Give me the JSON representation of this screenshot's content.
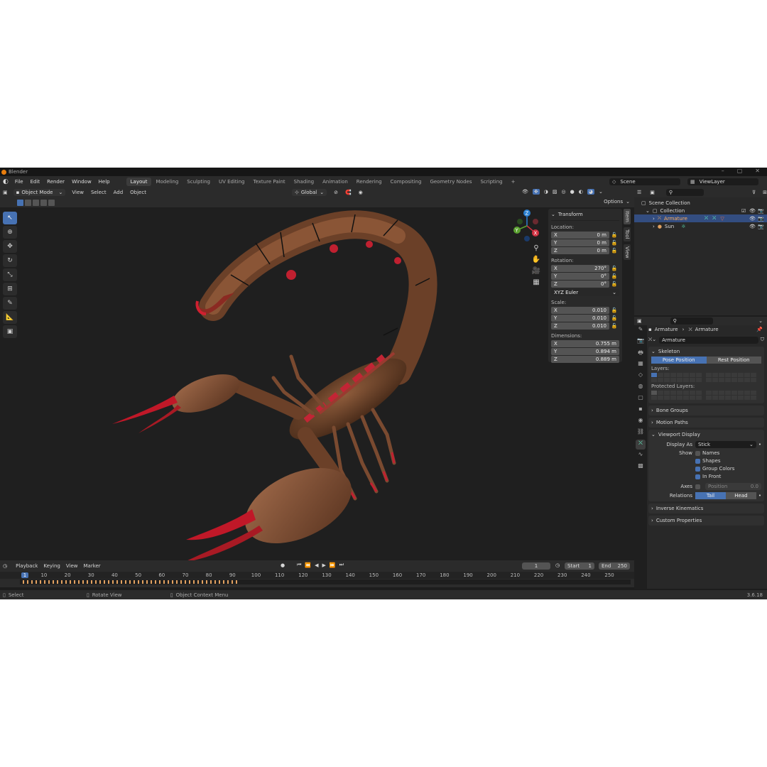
{
  "titlebar": {
    "title": "Blender"
  },
  "topbar": {
    "menus": [
      "File",
      "Edit",
      "Render",
      "Window",
      "Help"
    ],
    "workspaces": [
      "Layout",
      "Modeling",
      "Sculpting",
      "UV Editing",
      "Texture Paint",
      "Shading",
      "Animation",
      "Rendering",
      "Compositing",
      "Geometry Nodes",
      "Scripting"
    ],
    "active_workspace": "Layout",
    "add_tab": "+",
    "scene": "Scene",
    "view_layer": "ViewLayer"
  },
  "viewport_header": {
    "mode": "Object Mode",
    "menus": [
      "View",
      "Select",
      "Add",
      "Object"
    ],
    "orientation": "Global",
    "options": "Options"
  },
  "npanel": {
    "title": "Transform",
    "location_label": "Location:",
    "location": [
      {
        "axis": "X",
        "value": "0 m"
      },
      {
        "axis": "Y",
        "value": "0 m"
      },
      {
        "axis": "Z",
        "value": "0 m"
      }
    ],
    "rotation_label": "Rotation:",
    "rotation": [
      {
        "axis": "X",
        "value": "270°"
      },
      {
        "axis": "Y",
        "value": "0°"
      },
      {
        "axis": "Z",
        "value": "0°"
      }
    ],
    "rotation_mode": "XYZ Euler",
    "scale_label": "Scale:",
    "scale": [
      {
        "axis": "X",
        "value": "0.010"
      },
      {
        "axis": "Y",
        "value": "0.010"
      },
      {
        "axis": "Z",
        "value": "0.010"
      }
    ],
    "dimensions_label": "Dimensions:",
    "dimensions": [
      {
        "axis": "X",
        "value": "0.755 m"
      },
      {
        "axis": "Y",
        "value": "0.894 m"
      },
      {
        "axis": "Z",
        "value": "0.889 m"
      }
    ],
    "tabs": [
      "Item",
      "Tool",
      "View"
    ]
  },
  "gizmo": {
    "x": "X",
    "y": "Y",
    "z": "Z"
  },
  "timeline": {
    "menus": [
      "Playback",
      "Keying",
      "View",
      "Marker"
    ],
    "current_frame": "1",
    "start_label": "Start",
    "start": "1",
    "end_label": "End",
    "end": "250",
    "ruler": [
      "1",
      "10",
      "20",
      "30",
      "40",
      "50",
      "60",
      "70",
      "80",
      "90",
      "100",
      "110",
      "120",
      "130",
      "140",
      "150",
      "160",
      "170",
      "180",
      "190",
      "200",
      "210",
      "220",
      "230",
      "240",
      "250"
    ]
  },
  "statusbar": {
    "select": "Select",
    "rotate": "Rotate View",
    "context": "Object Context Menu",
    "version": "3.6.18"
  },
  "outliner": {
    "root": "Scene Collection",
    "collection": "Collection",
    "items": [
      "Armature",
      "Sun"
    ]
  },
  "properties": {
    "breadcrumb_object": "Armature",
    "breadcrumb_data": "Armature",
    "data_name": "Armature",
    "skeleton": {
      "title": "Skeleton",
      "pose_position": "Pose Position",
      "rest_position": "Rest Position",
      "layers_label": "Layers:",
      "protected_label": "Protected Layers:"
    },
    "bone_groups": "Bone Groups",
    "motion_paths": "Motion Paths",
    "viewport_display": {
      "title": "Viewport Display",
      "display_as_label": "Display As",
      "display_as": "Stick",
      "show_label": "Show",
      "names": "Names",
      "shapes": "Shapes",
      "group_colors": "Group Colors",
      "in_front": "In Front",
      "axes_label": "Axes",
      "position_label": "Position",
      "position_value": "0.0",
      "relations_label": "Relations",
      "tail": "Tail",
      "head": "Head"
    },
    "inverse_kinematics": "Inverse Kinematics",
    "custom_properties": "Custom Properties"
  },
  "colors": {
    "accent": "#4772b3",
    "background": "#1d1d1d",
    "panel": "#303030",
    "orange": "#e87d0d"
  }
}
